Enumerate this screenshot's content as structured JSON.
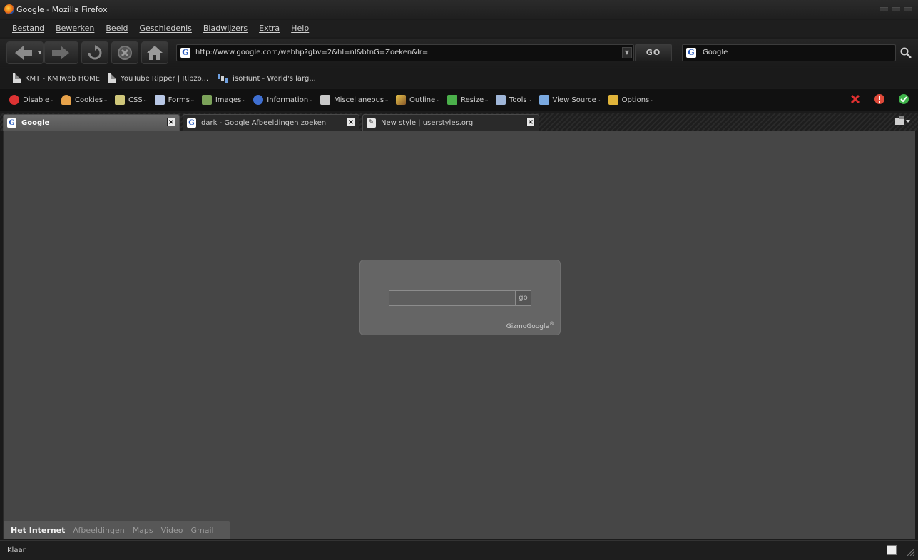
{
  "window": {
    "title": "Google - Mozilla Firefox"
  },
  "menubar": {
    "items": [
      "Bestand",
      "Bewerken",
      "Beeld",
      "Geschiedenis",
      "Bladwijzers",
      "Extra",
      "Help"
    ]
  },
  "navbar": {
    "url": "http://www.google.com/webhp?gbv=2&hl=nl&btnG=Zoeken&lr=",
    "go_label": "GO",
    "search_value": "Google"
  },
  "bookmarks": {
    "items": [
      "KMT - KMTweb HOME",
      "YouTube Ripper | Ripzo...",
      "isoHunt - World's larg..."
    ]
  },
  "devbar": {
    "items": [
      "Disable",
      "Cookies",
      "CSS",
      "Forms",
      "Images",
      "Information",
      "Miscellaneous",
      "Outline",
      "Resize",
      "Tools",
      "View Source",
      "Options"
    ]
  },
  "tabs": [
    {
      "label": "Google",
      "active": true
    },
    {
      "label": "dark - Google Afbeeldingen zoeken",
      "active": false
    },
    {
      "label": "New style | userstyles.org",
      "active": false
    }
  ],
  "content": {
    "search_input_value": "",
    "go_label": "go",
    "brand": "GizmoGoogle",
    "brand_mark": "®",
    "bottom_nav": [
      "Het Internet",
      "Afbeeldingen",
      "Maps",
      "Video",
      "Gmail"
    ]
  },
  "statusbar": {
    "text": "Klaar"
  },
  "colors": {
    "content_bg": "#464646",
    "box_bg": "#656565",
    "chrome_bg": "#1b1b1b"
  }
}
